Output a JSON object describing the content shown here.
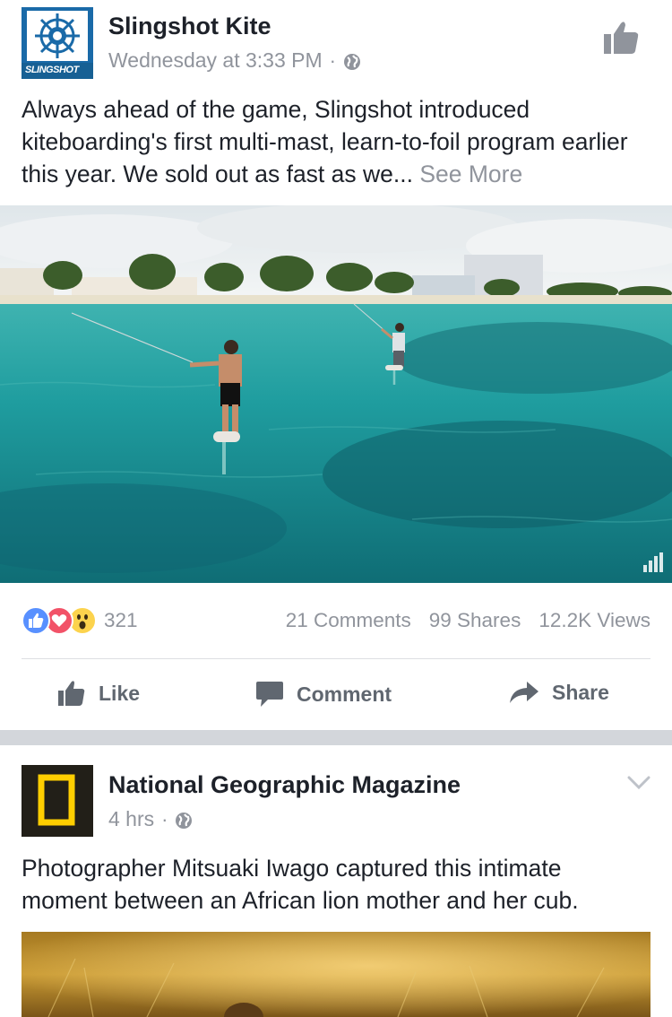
{
  "post1": {
    "page_name": "Slingshot Kite",
    "timestamp": "Wednesday at 3:33 PM",
    "separator": "·",
    "avatar_text": "SLINGSHOT",
    "body": "Always ahead of the game, Slingshot introduced kiteboarding's first multi-mast, learn-to-foil program earlier this year. We sold out as fast as we...",
    "see_more": "See More",
    "reaction_count": "321",
    "comments": "21 Comments",
    "shares": "99 Shares",
    "views": "12.2K Views",
    "actions": {
      "like": "Like",
      "comment": "Comment",
      "share": "Share"
    }
  },
  "post2": {
    "page_name": "National Geographic Magazine",
    "timestamp": "4 hrs",
    "separator": "·",
    "body": "Photographer Mitsuaki Iwago captured this intimate moment between an African lion mother and her cub."
  },
  "colors": {
    "like_blue": "#5890ff",
    "love_red": "#f25268",
    "wow_yellow": "#fcd34d",
    "meta_gray": "#90949c",
    "action_gray": "#606770",
    "natgeo_yellow": "#ffce00"
  },
  "icons": {
    "page_like": "thumbs-up-icon",
    "privacy": "globe-icon",
    "menu": "chevron-down-icon",
    "video_quality": "signal-bars-icon"
  }
}
